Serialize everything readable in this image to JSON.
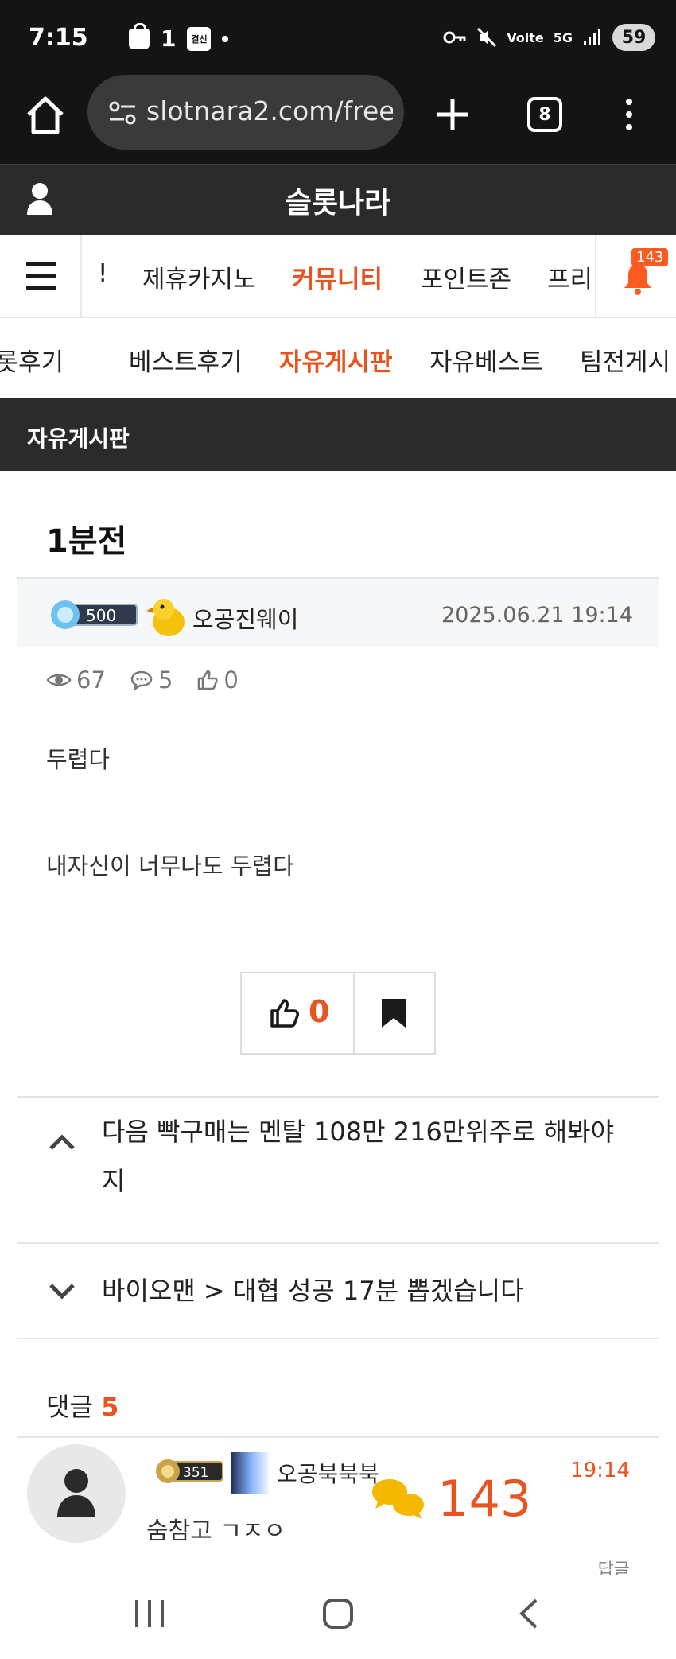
{
  "status_bar": {
    "time": "7:15",
    "indicator_one": "1",
    "pay_label": "결신",
    "network": "5G",
    "battery": "59"
  },
  "browser": {
    "url": "slotnara2.com/free",
    "tab_count": "8"
  },
  "site": {
    "title": "슬롯나라"
  },
  "main_nav": {
    "items": [
      "!",
      "제휴카지노",
      "커뮤니티",
      "포인트존",
      "프리"
    ],
    "active": "커뮤니티",
    "notification_count": "143"
  },
  "sub_nav": {
    "items": [
      "슬롯후기",
      "베스트후기",
      "자유게시판",
      "자유베스트",
      "팀전게시"
    ],
    "active": "자유게시판"
  },
  "board": {
    "title": "자유게시판"
  },
  "post": {
    "title": "1분전",
    "author": "오공진웨이",
    "level": "500",
    "date": "2025.06.21 19:14",
    "views": "67",
    "comments": "5",
    "likes": "0",
    "body": [
      "두렵다",
      "내자신이 너무나도 두렵다"
    ],
    "vote_count": "0"
  },
  "prev_next": {
    "prev": "다음 빡구매는 멘탈 108만 216만위주로 해봐야 지",
    "next": "바이오맨 > 대협 성공 17분 뽑겠습니다"
  },
  "comments": {
    "label": "댓글",
    "count": "5",
    "items": [
      {
        "author": "오공북북북",
        "level": "351",
        "time": "19:14",
        "text": "숨참고 ㄱㅈㅇ",
        "reply_label": "답글"
      }
    ]
  },
  "chat_widget": {
    "count": "143"
  },
  "colors": {
    "accent": "#e8531f",
    "header_bg": "#2b2b2b",
    "status_bg": "#141414"
  }
}
